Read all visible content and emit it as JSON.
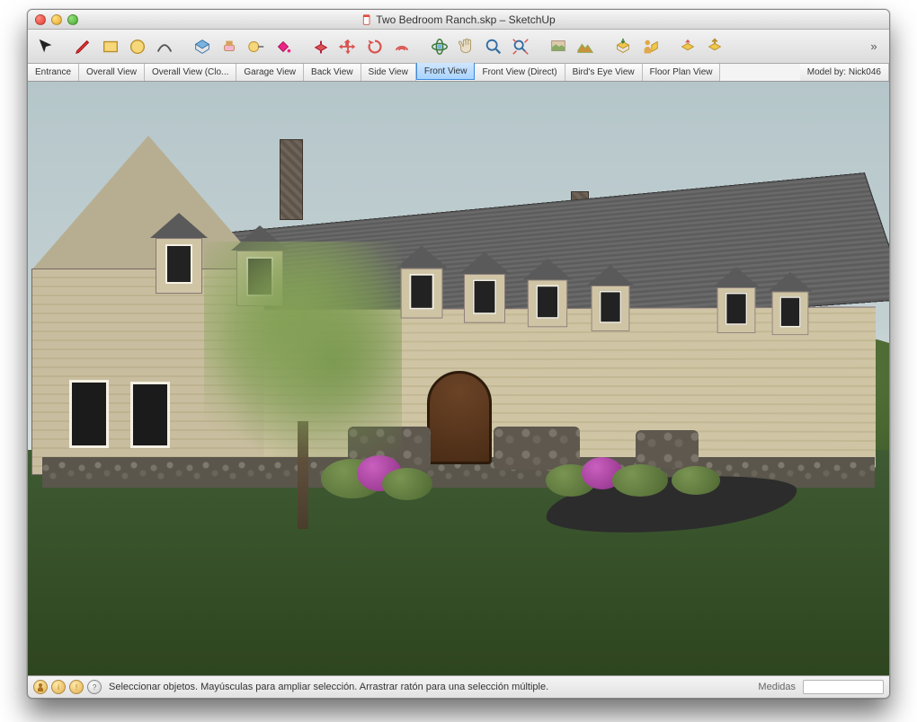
{
  "window": {
    "title": "Two Bedroom Ranch.skp – SketchUp"
  },
  "toolbar": {
    "tools": [
      "select",
      "pencil",
      "rectangle",
      "circle",
      "arc",
      "make-component",
      "eraser",
      "tape-measure",
      "paint-bucket",
      "push-pull",
      "move",
      "rotate",
      "offset",
      "orbit",
      "pan",
      "zoom",
      "zoom-extents",
      "add-location",
      "toggle-terrain",
      "get-models",
      "place-model",
      "upload",
      "preview"
    ],
    "overflow": "»"
  },
  "scenes": {
    "items": [
      "Entrance",
      "Overall View",
      "Overall View (Clo...",
      "Garage View",
      "Back View",
      "Side View",
      "Front View",
      "Front View (Direct)",
      "Bird's Eye View",
      "Floor Plan View"
    ],
    "active_index": 6,
    "credit": "Model by: Nick046"
  },
  "status": {
    "hint": "Seleccionar objetos. Mayúsculas para ampliar selección. Arrastrar ratón para una selección múltiple.",
    "measure_label": "Medidas",
    "measure_value": ""
  }
}
